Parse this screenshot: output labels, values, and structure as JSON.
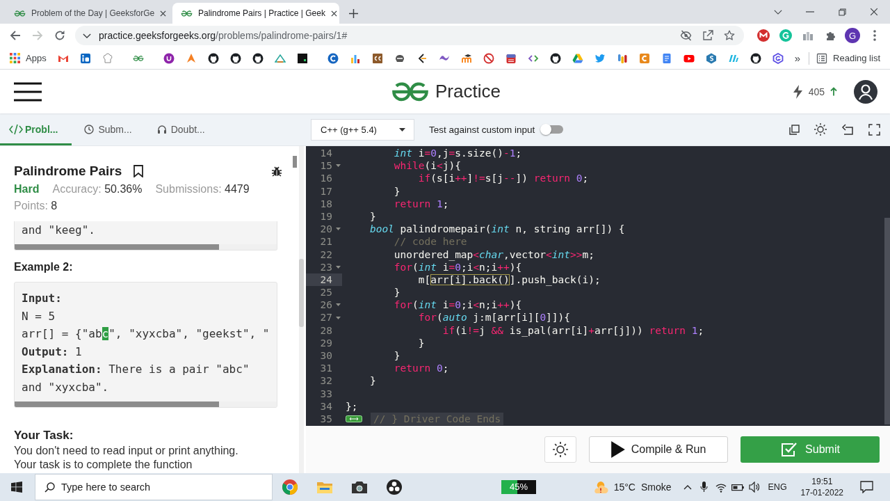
{
  "browser": {
    "tabs": [
      {
        "title": "Problem of the Day | GeeksforGe",
        "selected": false
      },
      {
        "title": "Palindrome Pairs | Practice | Geek",
        "selected": true
      }
    ],
    "nav": {
      "back_disabled": false,
      "forward_disabled": true
    },
    "url": {
      "host": "practice.geeksforgeeks.org",
      "path": "/problems/palindrome-pairs/1#"
    },
    "profile_initial": "G",
    "bookmarks": {
      "apps_label": "Apps",
      "overflow": "»",
      "reading_list": "Reading list"
    }
  },
  "header": {
    "brand": "Practice",
    "streak": "405"
  },
  "toolbar": {
    "tabs": [
      {
        "label": "Probl...",
        "selected": true
      },
      {
        "label": "Subm...",
        "selected": false
      },
      {
        "label": "Doubt...",
        "selected": false
      }
    ],
    "language": "C++ (g++ 5.4)",
    "custom_input": {
      "label": "Test against custom input",
      "on": false
    }
  },
  "problem": {
    "title": "Palindrome Pairs",
    "bookmarked": false,
    "difficulty": "Hard",
    "accuracy": {
      "label": "Accuracy:",
      "value": "50.36%"
    },
    "submissions": {
      "label": "Submissions:",
      "value": "4479"
    },
    "points": {
      "label": "Points:",
      "value": "8"
    },
    "example_1_tail": {
      "lines": [
        {
          "kind": "text",
          "text": "and \"keeg\"."
        }
      ]
    },
    "example_2": {
      "heading": "Example 2:",
      "lines": [
        {
          "kind": "label",
          "text": "Input:"
        },
        {
          "kind": "text",
          "text": "N = 5"
        },
        {
          "kind": "selection",
          "parts": [
            {
              "text": "arr[] = {\"ab",
              "highlighted": false
            },
            {
              "text": "c",
              "highlighted": true
            },
            {
              "text": "\", \"xyxcba\", \"geekst\", \"",
              "highlighted": false
            }
          ]
        },
        {
          "kind": "text",
          "text": "**Output:** 1"
        },
        {
          "kind": "text",
          "text": "**Explanation:** There is a pair \"abc\""
        },
        {
          "kind": "text",
          "text": "and \"xyxcba\"."
        }
      ]
    },
    "task": {
      "heading": "Your Task:",
      "sentences": [
        "You don't need to read input or print anything.",
        "Your task is to complete the function"
      ]
    }
  },
  "editor": {
    "lines": [
      {
        "number": "14",
        "kind": "code",
        "active": false,
        "foldable": false,
        "tokens": [
          {
            "kind": "type",
            "text": "        int"
          },
          {
            "kind": "plain",
            "text": " i"
          },
          {
            "kind": "keyword",
            "text": "="
          },
          {
            "kind": "number",
            "text": "0"
          },
          {
            "kind": "plain",
            "text": ",j"
          },
          {
            "kind": "keyword",
            "text": "="
          },
          {
            "kind": "plain",
            "text": "s.size()"
          },
          {
            "kind": "keyword",
            "text": "-"
          },
          {
            "kind": "number",
            "text": "1"
          },
          {
            "kind": "plain",
            "text": ";"
          }
        ]
      },
      {
        "number": "15",
        "kind": "code",
        "active": false,
        "foldable": true,
        "tokens": [
          {
            "kind": "keyword",
            "text": "        while"
          },
          {
            "kind": "plain",
            "text": "(i"
          },
          {
            "kind": "keyword",
            "text": "<"
          },
          {
            "kind": "plain",
            "text": "j){"
          }
        ]
      },
      {
        "number": "16",
        "kind": "code",
        "active": false,
        "foldable": false,
        "tokens": [
          {
            "kind": "keyword",
            "text": "            if"
          },
          {
            "kind": "plain",
            "text": "(s[i"
          },
          {
            "kind": "keyword",
            "text": "++"
          },
          {
            "kind": "plain",
            "text": "]"
          },
          {
            "kind": "keyword",
            "text": "!="
          },
          {
            "kind": "plain",
            "text": "s[j"
          },
          {
            "kind": "keyword",
            "text": "--"
          },
          {
            "kind": "plain",
            "text": "]) "
          },
          {
            "kind": "keyword",
            "text": "return "
          },
          {
            "kind": "number",
            "text": "0"
          },
          {
            "kind": "plain",
            "text": ";"
          }
        ]
      },
      {
        "number": "17",
        "kind": "code",
        "active": false,
        "foldable": false,
        "tokens": [
          {
            "kind": "plain",
            "text": "        }"
          }
        ]
      },
      {
        "number": "18",
        "kind": "code",
        "active": false,
        "foldable": false,
        "tokens": [
          {
            "kind": "keyword",
            "text": "        return "
          },
          {
            "kind": "number",
            "text": "1"
          },
          {
            "kind": "plain",
            "text": ";"
          }
        ]
      },
      {
        "number": "19",
        "kind": "code",
        "active": false,
        "foldable": false,
        "tokens": [
          {
            "kind": "plain",
            "text": "    }"
          }
        ]
      },
      {
        "number": "20",
        "kind": "code",
        "active": false,
        "foldable": true,
        "tokens": [
          {
            "kind": "type",
            "text": "    bool"
          },
          {
            "kind": "plain",
            "text": " palindromepair("
          },
          {
            "kind": "type",
            "text": "int"
          },
          {
            "kind": "plain",
            "text": " n, string arr[]) {"
          }
        ]
      },
      {
        "number": "21",
        "kind": "code",
        "active": false,
        "foldable": false,
        "tokens": [
          {
            "kind": "comment",
            "text": "        // code here"
          }
        ]
      },
      {
        "number": "22",
        "kind": "code",
        "active": false,
        "foldable": false,
        "tokens": [
          {
            "kind": "plain",
            "text": "        unordered_map"
          },
          {
            "kind": "keyword",
            "text": "<"
          },
          {
            "kind": "type",
            "text": "char"
          },
          {
            "kind": "plain",
            "text": ",vector"
          },
          {
            "kind": "keyword",
            "text": "<"
          },
          {
            "kind": "type",
            "text": "int"
          },
          {
            "kind": "keyword",
            "text": ">>"
          },
          {
            "kind": "plain",
            "text": "m;"
          }
        ]
      },
      {
        "number": "23",
        "kind": "code",
        "active": false,
        "foldable": true,
        "tokens": [
          {
            "kind": "keyword",
            "text": "        for"
          },
          {
            "kind": "plain",
            "text": "("
          },
          {
            "kind": "type",
            "text": "int"
          },
          {
            "kind": "plain",
            "text": " i"
          },
          {
            "kind": "keyword",
            "text": "="
          },
          {
            "kind": "number",
            "text": "0"
          },
          {
            "kind": "plain",
            "text": ";i"
          },
          {
            "kind": "keyword",
            "text": "<"
          },
          {
            "kind": "plain",
            "text": "n;i"
          },
          {
            "kind": "keyword",
            "text": "++"
          },
          {
            "kind": "plain",
            "text": "){"
          }
        ]
      },
      {
        "number": "24",
        "kind": "code",
        "active": true,
        "foldable": false,
        "tokens": [
          {
            "kind": "plain",
            "text": "            m["
          },
          {
            "kind": "match",
            "text": "arr[i].back()"
          },
          {
            "kind": "plain",
            "text": "].push_back(i);"
          }
        ]
      },
      {
        "number": "25",
        "kind": "code",
        "active": false,
        "foldable": false,
        "tokens": [
          {
            "kind": "plain",
            "text": "        }"
          }
        ]
      },
      {
        "number": "26",
        "kind": "code",
        "active": false,
        "foldable": true,
        "tokens": [
          {
            "kind": "keyword",
            "text": "        for"
          },
          {
            "kind": "plain",
            "text": "("
          },
          {
            "kind": "type",
            "text": "int"
          },
          {
            "kind": "plain",
            "text": " i"
          },
          {
            "kind": "keyword",
            "text": "="
          },
          {
            "kind": "number",
            "text": "0"
          },
          {
            "kind": "plain",
            "text": ";i"
          },
          {
            "kind": "keyword",
            "text": "<"
          },
          {
            "kind": "plain",
            "text": "n;i"
          },
          {
            "kind": "keyword",
            "text": "++"
          },
          {
            "kind": "plain",
            "text": "){"
          }
        ]
      },
      {
        "number": "27",
        "kind": "code",
        "active": false,
        "foldable": true,
        "tokens": [
          {
            "kind": "keyword",
            "text": "            for"
          },
          {
            "kind": "plain",
            "text": "("
          },
          {
            "kind": "type",
            "text": "auto"
          },
          {
            "kind": "plain",
            "text": " j:m[arr[i]["
          },
          {
            "kind": "number",
            "text": "0"
          },
          {
            "kind": "plain",
            "text": "]]){"
          }
        ]
      },
      {
        "number": "28",
        "kind": "code",
        "active": false,
        "foldable": false,
        "tokens": [
          {
            "kind": "keyword",
            "text": "                if"
          },
          {
            "kind": "plain",
            "text": "(i"
          },
          {
            "kind": "keyword",
            "text": "!="
          },
          {
            "kind": "plain",
            "text": "j "
          },
          {
            "kind": "keyword",
            "text": "&&"
          },
          {
            "kind": "plain",
            "text": " is_pal(arr[i]"
          },
          {
            "kind": "keyword",
            "text": "+"
          },
          {
            "kind": "plain",
            "text": "arr[j])) "
          },
          {
            "kind": "keyword",
            "text": "return "
          },
          {
            "kind": "number",
            "text": "1"
          },
          {
            "kind": "plain",
            "text": ";"
          }
        ]
      },
      {
        "number": "29",
        "kind": "code",
        "active": false,
        "foldable": false,
        "tokens": [
          {
            "kind": "plain",
            "text": "            }"
          }
        ]
      },
      {
        "number": "30",
        "kind": "code",
        "active": false,
        "foldable": false,
        "tokens": [
          {
            "kind": "plain",
            "text": "        }"
          }
        ]
      },
      {
        "number": "31",
        "kind": "code",
        "active": false,
        "foldable": false,
        "tokens": [
          {
            "kind": "keyword",
            "text": "        return "
          },
          {
            "kind": "number",
            "text": "0"
          },
          {
            "kind": "plain",
            "text": ";"
          }
        ]
      },
      {
        "number": "32",
        "kind": "code",
        "active": false,
        "foldable": false,
        "tokens": [
          {
            "kind": "plain",
            "text": "    }"
          }
        ]
      },
      {
        "number": "33",
        "kind": "code",
        "active": false,
        "foldable": false
      },
      {
        "number": "34",
        "kind": "code",
        "active": false,
        "foldable": false,
        "tokens": [
          {
            "kind": "plain",
            "text": "};"
          }
        ]
      },
      {
        "number": "35",
        "kind": "fold",
        "active": false,
        "foldable": false,
        "tokens": [
          {
            "kind": "comment",
            "text": "// } Driver Code Ends"
          }
        ]
      }
    ]
  },
  "actions": {
    "run": "Compile & Run",
    "submit": "Submit"
  },
  "taskbar": {
    "search_placeholder": "Type here to search",
    "meter": {
      "reading": "45%",
      "level": 0.45
    },
    "weather": {
      "temperature": "15°C",
      "condition": "Smoke"
    },
    "language": "ENG",
    "time": "19:51",
    "date": "17-01-2022"
  }
}
